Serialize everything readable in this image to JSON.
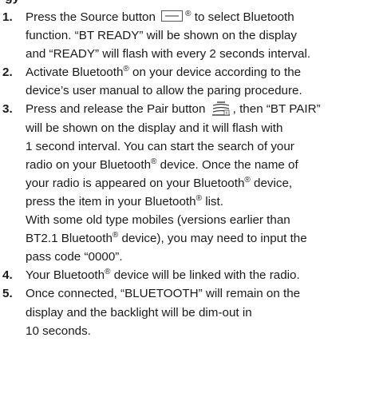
{
  "heading_partial": "gy",
  "steps": [
    {
      "number": "1.",
      "lines": [
        {
          "a": "Press the Source button ",
          "icon": "source-button-icon",
          "b": " to select Bluetooth",
          "sup": "®"
        },
        {
          "a": "function. “BT READY” will be shown on the display"
        },
        {
          "a": "and “READY” will flash with every 2 seconds interval."
        }
      ]
    },
    {
      "number": "2.",
      "lines": [
        {
          "a": "Activate Bluetooth",
          "sup": "®",
          "b": " on your device according to the"
        },
        {
          "a": "device’s user manual to allow the paring procedure."
        }
      ]
    },
    {
      "number": "3.",
      "lines": [
        {
          "a": "Press and release the Pair button ",
          "icon": "pair-button-icon",
          "b": ", then “BT PAIR”"
        },
        {
          "a": "will be shown on the display and it will flash with"
        },
        {
          "a": "1 second interval. You can start the search of your"
        },
        {
          "a": "radio on your Bluetooth",
          "sup": "®",
          "b": " device. Once the name of"
        },
        {
          "a": "your radio is appeared on your Bluetooth",
          "sup": "®",
          "b": " device,"
        },
        {
          "a": "press the item in your Bluetooth",
          "sup": "®",
          "b": " list."
        },
        {
          "a": "With some old type mobiles (versions earlier than"
        },
        {
          "a": "BT2.1 Bluetooth",
          "sup": "®",
          "b": " device), you may need to input the"
        },
        {
          "a": "pass code “0000”."
        }
      ]
    },
    {
      "number": "4.",
      "lines": [
        {
          "a": "Your Bluetooth",
          "sup": "®",
          "b": " device will be linked with the radio."
        }
      ]
    },
    {
      "number": "5.",
      "lines": [
        {
          "a": "Once connected, “BLUETOOTH” will remain on the"
        },
        {
          "a": "display and the backlight will be dim-out in"
        },
        {
          "a": "10 seconds."
        }
      ]
    }
  ]
}
